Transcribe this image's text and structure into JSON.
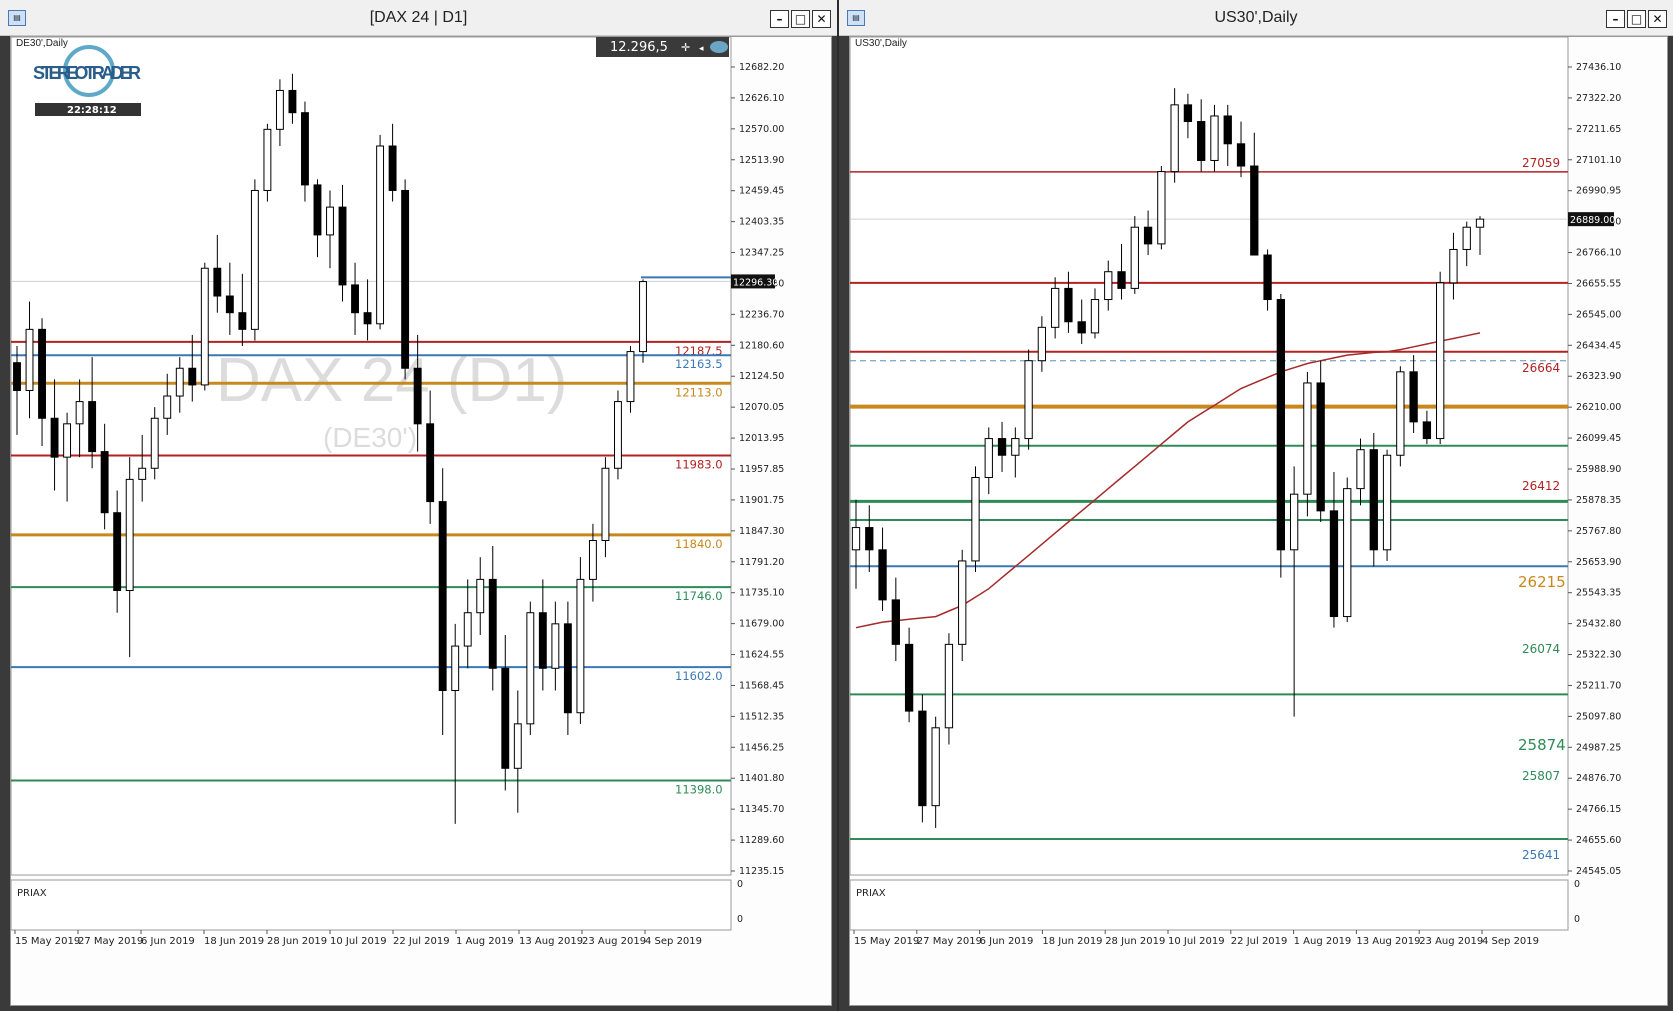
{
  "left_window": {
    "title": "[DAX 24 | D1]",
    "symbol_label": "DE30',Daily",
    "watermark_main": "DAX 24 (D1)",
    "watermark_sub": "(DE30')",
    "logo_text": "STEREOTRADER",
    "clock": "22:28:12",
    "quote_box": "12.296,5",
    "current_price": "12296.30",
    "indicator_label": "PRIAX",
    "indicator_ticks": [
      "0",
      "0"
    ],
    "y_ticks": [
      "12682.20",
      "12626.10",
      "12570.00",
      "12513.90",
      "12459.45",
      "12403.35",
      "12347.25",
      "12296.30",
      "12236.70",
      "12180.60",
      "12124.50",
      "12070.05",
      "12013.95",
      "11957.85",
      "11901.75",
      "11847.30",
      "11791.20",
      "11735.10",
      "11679.00",
      "11624.55",
      "11568.45",
      "11512.35",
      "11456.25",
      "11401.80",
      "11345.70",
      "11289.60",
      "11235.15"
    ],
    "x_ticks": [
      "15 May 2019",
      "27 May 2019",
      "6 Jun 2019",
      "18 Jun 2019",
      "28 Jun 2019",
      "10 Jul 2019",
      "22 Jul 2019",
      "1 Aug 2019",
      "13 Aug 2019",
      "23 Aug 2019",
      "4 Sep 2019"
    ],
    "levels": [
      {
        "label": "12187.5",
        "value": 12187.5,
        "color": "#b22222"
      },
      {
        "label": "12163.5",
        "value": 12163.5,
        "color": "#3a78b5"
      },
      {
        "label": "12113.0",
        "value": 12113.0,
        "color": "#c8881e"
      },
      {
        "label": "11983.0",
        "value": 11983.0,
        "color": "#b22222"
      },
      {
        "label": "11840.0",
        "value": 11840.0,
        "color": "#c8881e"
      },
      {
        "label": "11746.0",
        "value": 11746.0,
        "color": "#2e8b57"
      },
      {
        "label": "11602.0",
        "value": 11602.0,
        "color": "#3a78b5"
      },
      {
        "label": "11398.0",
        "value": 11398.0,
        "color": "#2e8b57"
      }
    ]
  },
  "right_window": {
    "title": "US30',Daily",
    "symbol_label": "US30',Daily",
    "current_price": "26889.00",
    "indicator_label": "PRIAX",
    "indicator_ticks": [
      "0",
      "0"
    ],
    "y_ticks": [
      "27436.10",
      "27322.20",
      "27211.65",
      "27101.10",
      "26990.95",
      "26889.00",
      "26766.10",
      "26655.55",
      "26545.00",
      "26434.45",
      "26323.90",
      "26210.00",
      "26099.45",
      "25988.90",
      "25878.35",
      "25767.80",
      "25653.90",
      "25543.35",
      "25432.80",
      "25322.30",
      "25211.70",
      "25097.80",
      "24987.25",
      "24876.70",
      "24766.15",
      "24655.60",
      "24545.05"
    ],
    "x_ticks": [
      "15 May 2019",
      "27 May 2019",
      "6 Jun 2019",
      "18 Jun 2019",
      "28 Jun 2019",
      "10 Jul 2019",
      "22 Jul 2019",
      "1 Aug 2019",
      "13 Aug 2019",
      "23 Aug 2019",
      "4 Sep 2019"
    ],
    "level_lines": [
      {
        "value": 27059,
        "color": "#b22222",
        "width": 1.5
      },
      {
        "value": 26660,
        "color": "#b22222",
        "width": 2
      },
      {
        "value": 26412,
        "color": "#b22222",
        "width": 2
      },
      {
        "value": 26215,
        "color": "#c8881e",
        "width": 4
      },
      {
        "value": 26074,
        "color": "#2e8b57",
        "width": 2
      },
      {
        "value": 25874,
        "color": "#2e8b57",
        "width": 3
      },
      {
        "value": 25807,
        "color": "#2e8b57",
        "width": 2
      },
      {
        "value": 25641,
        "color": "#3a78b5",
        "width": 2
      },
      {
        "value": 25180,
        "color": "#2e8b57",
        "width": 2
      },
      {
        "value": 24660,
        "color": "#2e8b57",
        "width": 2
      }
    ],
    "level_labels": [
      {
        "label": "27059",
        "color": "#b22222",
        "size": 12
      },
      {
        "label": "26664",
        "color": "#b22222",
        "size": 12
      },
      {
        "label": "26412",
        "color": "#b22222",
        "size": 12
      },
      {
        "label": "26215",
        "color": "#c8881e",
        "size": 15
      },
      {
        "label": "26074",
        "color": "#2e8b57",
        "size": 12
      },
      {
        "label": "25874",
        "color": "#2e8b57",
        "size": 15
      },
      {
        "label": "25807",
        "color": "#2e8b57",
        "size": 12
      },
      {
        "label": "25641",
        "color": "#3a78b5",
        "size": 12
      }
    ]
  },
  "colors": {
    "bull_fill": "#ffffff",
    "bear_fill": "#000000",
    "ma_line": "#a52a2a"
  },
  "chart_data": [
    {
      "type": "candlestick",
      "title": "DE30',Daily",
      "ylim": [
        11235.15,
        12682.2
      ],
      "x": [
        "15 May 2019",
        "27 May 2019",
        "6 Jun 2019",
        "18 Jun 2019",
        "28 Jun 2019",
        "10 Jul 2019",
        "22 Jul 2019",
        "1 Aug 2019",
        "13 Aug 2019",
        "23 Aug 2019",
        "4 Sep 2019"
      ],
      "ohlc": [
        [
          12150,
          12180,
          12020,
          12100
        ],
        [
          12100,
          12260,
          12050,
          12210
        ],
        [
          12210,
          12230,
          12000,
          12050
        ],
        [
          12050,
          12120,
          11920,
          11980
        ],
        [
          11980,
          12060,
          11900,
          12040
        ],
        [
          12040,
          12120,
          11980,
          12080
        ],
        [
          12080,
          12160,
          11960,
          11990
        ],
        [
          11990,
          12040,
          11850,
          11880
        ],
        [
          11880,
          11920,
          11700,
          11740
        ],
        [
          11740,
          11980,
          11620,
          11940
        ],
        [
          11940,
          12020,
          11900,
          11960
        ],
        [
          11960,
          12070,
          11940,
          12050
        ],
        [
          12050,
          12130,
          12020,
          12090
        ],
        [
          12090,
          12160,
          12060,
          12140
        ],
        [
          12140,
          12200,
          12080,
          12110
        ],
        [
          12110,
          12330,
          12100,
          12320
        ],
        [
          12320,
          12380,
          12240,
          12270
        ],
        [
          12270,
          12330,
          12200,
          12240
        ],
        [
          12240,
          12310,
          12180,
          12210
        ],
        [
          12210,
          12480,
          12190,
          12460
        ],
        [
          12460,
          12580,
          12440,
          12570
        ],
        [
          12570,
          12660,
          12540,
          12640
        ],
        [
          12640,
          12670,
          12580,
          12600
        ],
        [
          12600,
          12620,
          12440,
          12470
        ],
        [
          12470,
          12480,
          12340,
          12380
        ],
        [
          12380,
          12460,
          12320,
          12430
        ],
        [
          12430,
          12470,
          12260,
          12290
        ],
        [
          12290,
          12330,
          12200,
          12240
        ],
        [
          12240,
          12300,
          12190,
          12220
        ],
        [
          12220,
          12560,
          12210,
          12540
        ],
        [
          12540,
          12580,
          12440,
          12460
        ],
        [
          12460,
          12480,
          12120,
          12140
        ],
        [
          12140,
          12200,
          11990,
          12040
        ],
        [
          12040,
          12100,
          11860,
          11900
        ],
        [
          11900,
          11960,
          11480,
          11560
        ],
        [
          11560,
          11680,
          11320,
          11640
        ],
        [
          11640,
          11760,
          11600,
          11700
        ],
        [
          11700,
          11800,
          11660,
          11760
        ],
        [
          11760,
          11820,
          11560,
          11600
        ],
        [
          11600,
          11660,
          11380,
          11420
        ],
        [
          11420,
          11560,
          11340,
          11500
        ],
        [
          11500,
          11720,
          11480,
          11700
        ],
        [
          11700,
          11760,
          11560,
          11600
        ],
        [
          11600,
          11720,
          11560,
          11680
        ],
        [
          11680,
          11720,
          11480,
          11520
        ],
        [
          11520,
          11800,
          11500,
          11760
        ],
        [
          11760,
          11860,
          11720,
          11830
        ],
        [
          11830,
          11980,
          11800,
          11960
        ],
        [
          11960,
          12100,
          11940,
          12080
        ],
        [
          12080,
          12180,
          12060,
          12170
        ],
        [
          12170,
          12300,
          12150,
          12296
        ]
      ]
    },
    {
      "type": "candlestick",
      "title": "US30',Daily",
      "ylim": [
        24545.05,
        27436.1
      ],
      "x": [
        "15 May 2019",
        "27 May 2019",
        "6 Jun 2019",
        "18 Jun 2019",
        "28 Jun 2019",
        "10 Jul 2019",
        "22 Jul 2019",
        "1 Aug 2019",
        "13 Aug 2019",
        "23 Aug 2019",
        "4 Sep 2019"
      ],
      "ohlc": [
        [
          25700,
          25880,
          25560,
          25780
        ],
        [
          25780,
          25860,
          25620,
          25700
        ],
        [
          25700,
          25780,
          25480,
          25520
        ],
        [
          25520,
          25600,
          25300,
          25360
        ],
        [
          25360,
          25420,
          25080,
          25120
        ],
        [
          25120,
          25180,
          24720,
          24780
        ],
        [
          24780,
          25100,
          24700,
          25060
        ],
        [
          25060,
          25400,
          25000,
          25360
        ],
        [
          25360,
          25700,
          25300,
          25660
        ],
        [
          25660,
          26000,
          25620,
          25960
        ],
        [
          25960,
          26140,
          25900,
          26100
        ],
        [
          26100,
          26160,
          25980,
          26040
        ],
        [
          26040,
          26140,
          25960,
          26100
        ],
        [
          26100,
          26420,
          26060,
          26380
        ],
        [
          26380,
          26540,
          26340,
          26500
        ],
        [
          26500,
          26680,
          26460,
          26640
        ],
        [
          26640,
          26700,
          26480,
          26520
        ],
        [
          26520,
          26600,
          26440,
          26480
        ],
        [
          26480,
          26640,
          26460,
          26600
        ],
        [
          26600,
          26740,
          26560,
          26700
        ],
        [
          26700,
          26800,
          26600,
          26640
        ],
        [
          26640,
          26900,
          26620,
          26860
        ],
        [
          26860,
          26920,
          26760,
          26800
        ],
        [
          26800,
          27080,
          26780,
          27060
        ],
        [
          27060,
          27360,
          27020,
          27300
        ],
        [
          27300,
          27340,
          27180,
          27240
        ],
        [
          27240,
          27320,
          27060,
          27100
        ],
        [
          27100,
          27300,
          27060,
          27260
        ],
        [
          27260,
          27300,
          27080,
          27160
        ],
        [
          27160,
          27240,
          27040,
          27080
        ],
        [
          27080,
          27200,
          26920,
          26760
        ],
        [
          26760,
          26780,
          26560,
          26600
        ],
        [
          26600,
          26620,
          25600,
          25700
        ],
        [
          25700,
          26000,
          25100,
          25900
        ],
        [
          25900,
          26340,
          25820,
          26300
        ],
        [
          26300,
          26380,
          25800,
          25840
        ],
        [
          25840,
          25980,
          25420,
          25460
        ],
        [
          25460,
          25960,
          25440,
          25920
        ],
        [
          25920,
          26100,
          25860,
          26060
        ],
        [
          26060,
          26120,
          25640,
          25700
        ],
        [
          25700,
          26060,
          25660,
          26040
        ],
        [
          26040,
          26360,
          26000,
          26340
        ],
        [
          26340,
          26400,
          26120,
          26160
        ],
        [
          26160,
          26200,
          26080,
          26100
        ],
        [
          26100,
          26700,
          26080,
          26660
        ],
        [
          26660,
          26840,
          26600,
          26780
        ],
        [
          26780,
          26880,
          26720,
          26860
        ],
        [
          26860,
          26900,
          26760,
          26889
        ]
      ],
      "moving_average": [
        25420,
        25430,
        25440,
        25445,
        25450,
        25455,
        25460,
        25480,
        25500,
        25530,
        25560,
        25600,
        25640,
        25680,
        25720,
        25760,
        25800,
        25840,
        25880,
        25920,
        25960,
        26000,
        26040,
        26080,
        26120,
        26160,
        26190,
        26220,
        26250,
        26280,
        26300,
        26320,
        26340,
        26355,
        26370,
        26380,
        26390,
        26400,
        26405,
        26410,
        26412,
        26420,
        26430,
        26440,
        26450,
        26460,
        26470,
        26480
      ]
    }
  ]
}
